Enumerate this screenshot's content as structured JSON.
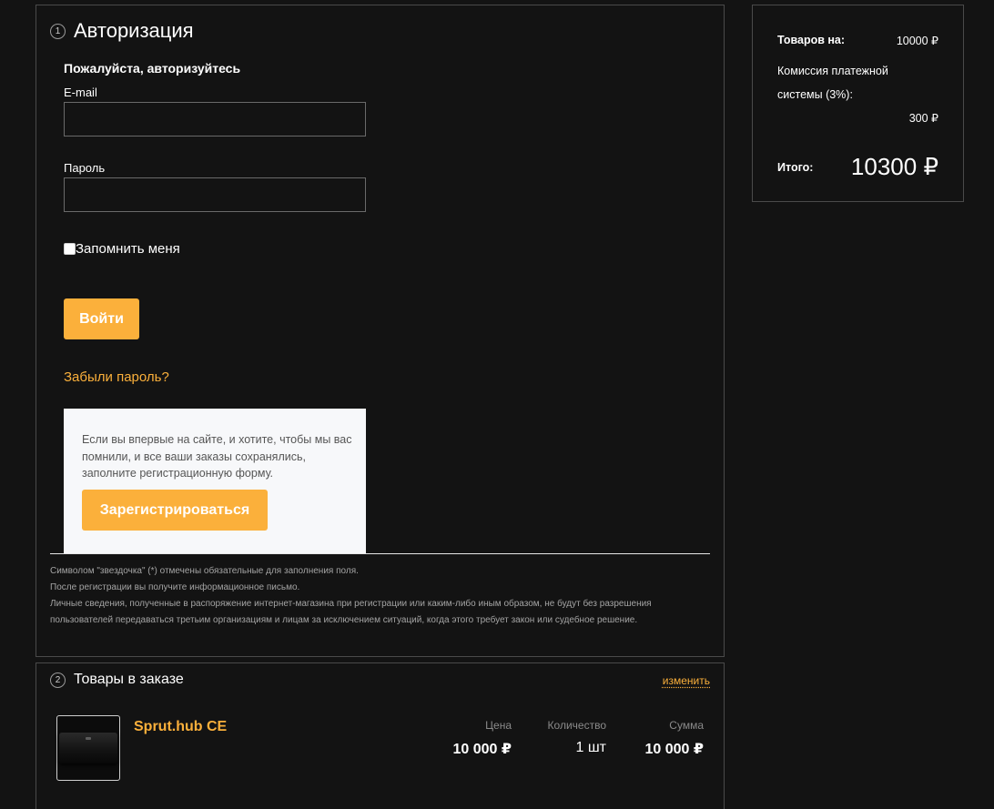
{
  "auth": {
    "step": "1",
    "title": "Авторизация",
    "subtitle": "Пожалуйста, авторизуйтесь",
    "email_label": "E-mail",
    "email_value": "",
    "password_label": "Пароль",
    "password_value": "",
    "remember_label": "Запомнить меня",
    "remember_checked": false,
    "login_button": "Войти",
    "forgot_link": "Забыли пароль?",
    "register_text": "Если вы впервые на сайте, и хотите, чтобы мы вас помнили, и все ваши заказы сохранялись, заполните регистрационную форму.",
    "register_button": "Зарегистрироваться",
    "notes": [
      "Символом \"звездочка\" (*) отмечены обязательные для заполнения поля.",
      "После регистрации вы получите информационное письмо.",
      "Личные сведения, полученные в распоряжение интернет-магазина при регистрации или каким-либо иным образом, не будут без разрешения пользователей передаваться третьим организациям и лицам за исключением ситуаций, когда этого требует закон или судебное решение."
    ]
  },
  "items": {
    "step": "2",
    "title": "Товары в заказе",
    "edit_link": "изменить",
    "columns": {
      "price": "Цена",
      "quantity": "Количество",
      "sum": "Сумма"
    },
    "products": [
      {
        "name": "Sprut.hub CE",
        "price": "10 000 ₽",
        "quantity": "1 шт",
        "sum": "10 000 ₽",
        "thumb_icon": "device-icon"
      }
    ]
  },
  "summary": {
    "goods_label": "Товаров на:",
    "goods_value": "10000 ₽",
    "commission_label_1": "Комиссия платежной",
    "commission_label_2": "системы (3%):",
    "commission_value": "300 ₽",
    "total_label": "Итого:",
    "total_value": "10300 ₽"
  },
  "colors": {
    "background": "#131313",
    "accent": "#fbb03b",
    "border": "#4a4a4a",
    "register_box": "#f7f8fa"
  }
}
